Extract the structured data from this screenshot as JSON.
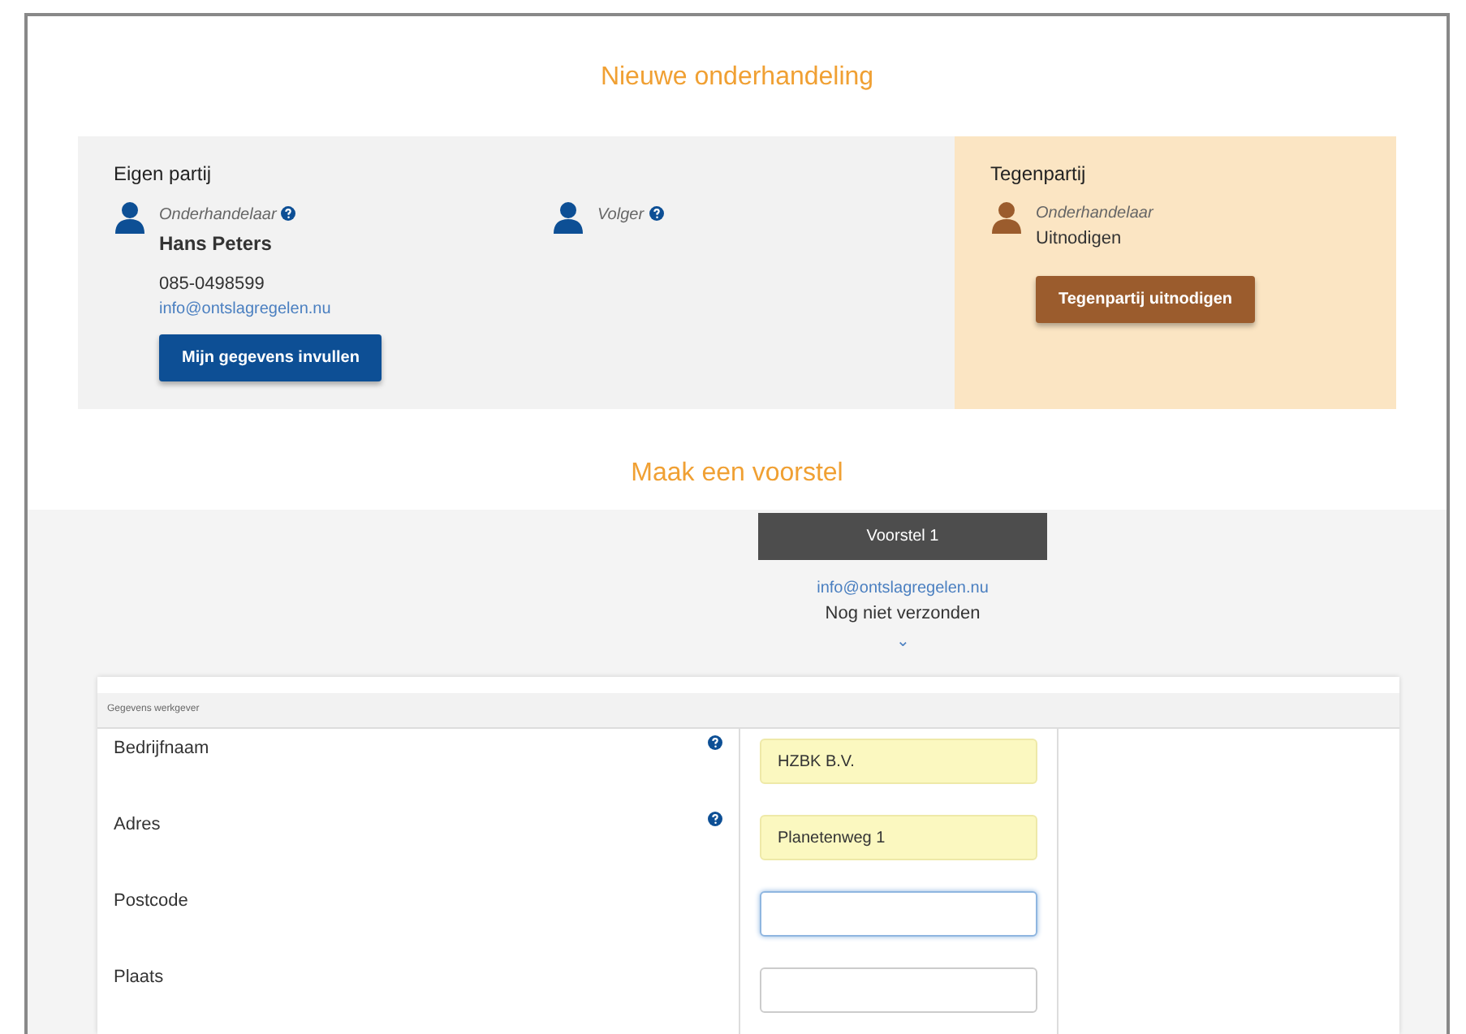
{
  "title": "Nieuwe onderhandeling",
  "own_party": {
    "heading": "Eigen partij",
    "negotiator": {
      "role": "Onderhandelaar",
      "help": true,
      "name": "Hans Peters",
      "phone": "085-0498599",
      "email": "info@ontslagregelen.nu"
    },
    "follower": {
      "role": "Volger",
      "help": true
    },
    "button": "Mijn gegevens invullen"
  },
  "counterparty": {
    "heading": "Tegenpartij",
    "negotiator": {
      "role": "Onderhandelaar",
      "status": "Uitnodigen"
    },
    "button": "Tegenpartij uitnodigen"
  },
  "proposal_heading": "Maak een voorstel",
  "proposal": {
    "tab": "Voorstel 1",
    "email": "info@ontslagregelen.nu",
    "status": "Nog niet verzonden",
    "chevron": "⌄"
  },
  "form": {
    "section": "Gegevens werkgever",
    "fields": [
      {
        "label": "Bedrijfnaam",
        "help": true,
        "value": "HZBK B.V.",
        "highlighted": true,
        "focused": false
      },
      {
        "label": "Adres",
        "help": true,
        "value": "Planetenweg 1",
        "highlighted": true,
        "focused": false
      },
      {
        "label": "Postcode",
        "help": false,
        "highlighted": false,
        "focused": true
      },
      {
        "label": "Plaats",
        "help": false,
        "highlighted": false,
        "focused": false
      }
    ]
  }
}
